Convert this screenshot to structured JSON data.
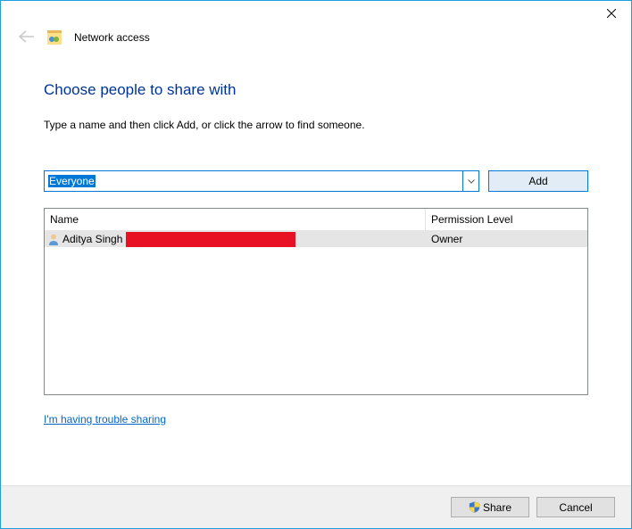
{
  "header": {
    "title": "Network access"
  },
  "main": {
    "heading": "Choose people to share with",
    "instruction": "Type a name and then click Add, or click the arrow to find someone."
  },
  "combo": {
    "value": "Everyone"
  },
  "buttons": {
    "add": "Add",
    "share": "Share",
    "cancel": "Cancel"
  },
  "table": {
    "col_name": "Name",
    "col_perm": "Permission Level",
    "rows": [
      {
        "name": "Aditya Singh",
        "perm": "Owner"
      }
    ]
  },
  "link": {
    "trouble": "I'm having trouble sharing"
  }
}
